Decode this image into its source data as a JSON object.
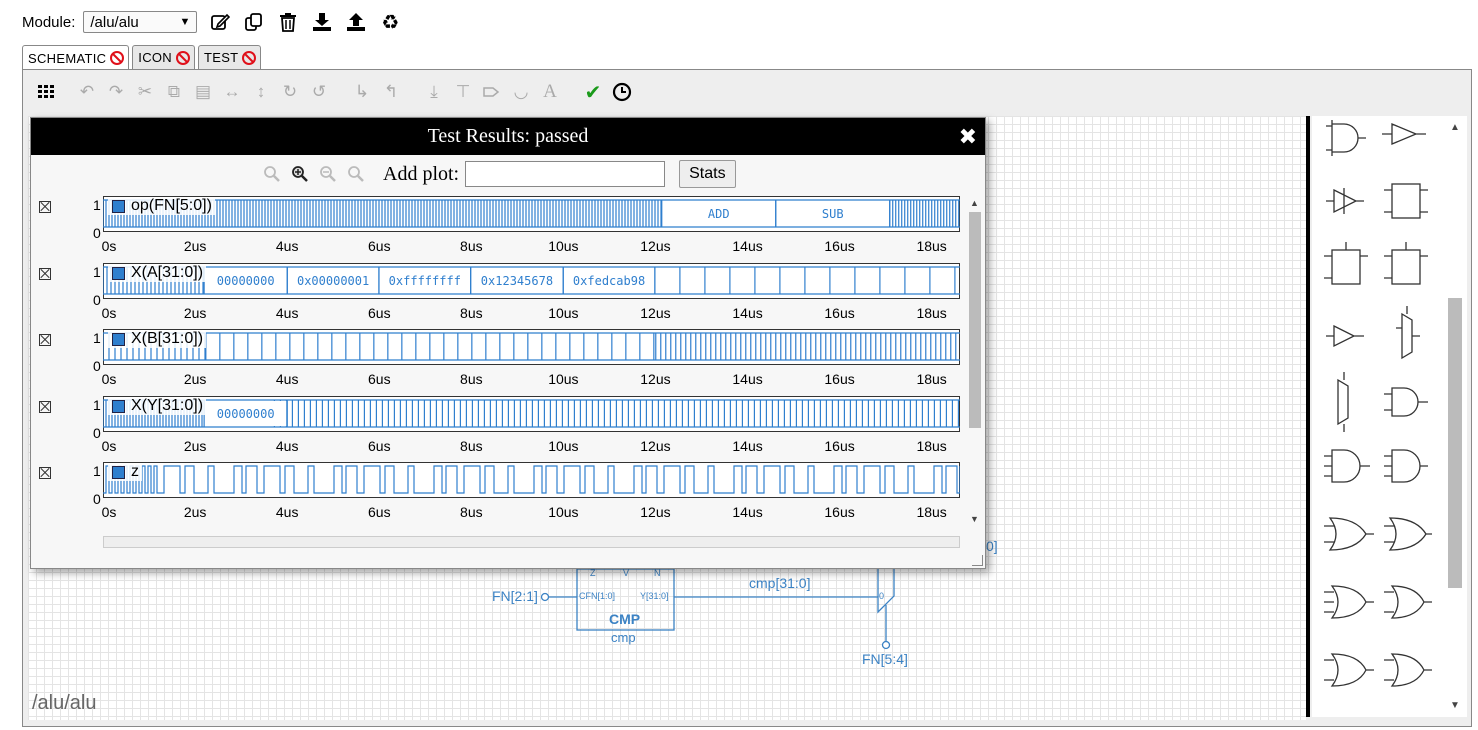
{
  "header": {
    "module_label": "Module:",
    "module_value": "/alu/alu"
  },
  "tabs": [
    {
      "label": "SCHEMATIC"
    },
    {
      "label": "ICON"
    },
    {
      "label": "TEST"
    }
  ],
  "canvas": {
    "module_path": "/alu/alu",
    "labels": {
      "fn21": "FN[2:1]",
      "fn54": "FN[5:4]",
      "cmp_bus": "cmp[31:0]",
      "cmp_title": "CMP",
      "cmp_inst": "cmp",
      "cfn": "CFN[1:0]",
      "y": "Y[31:0]",
      "z_pin": "Z",
      "v_pin": "V",
      "n_pin": "N",
      "mux_in": "0",
      "partial": "0]"
    }
  },
  "dialog": {
    "title": "Test Results: passed",
    "add_plot_label": "Add plot:",
    "add_plot_value": "",
    "stats_label": "Stats",
    "time_ticks": [
      "0s",
      "2us",
      "4us",
      "6us",
      "8us",
      "10us",
      "12us",
      "14us",
      "16us",
      "18us"
    ],
    "y_top": "1",
    "y_bottom": "0",
    "plots": [
      {
        "name": "op(FN[5:0])",
        "segments": [
          "ADD",
          "SUB"
        ]
      },
      {
        "name": "X(A[31:0])",
        "segments": [
          "00000000",
          "0x00000001",
          "0xffffffff",
          "0x12345678",
          "0xfedcab98"
        ]
      },
      {
        "name": "X(B[31:0])",
        "segments": []
      },
      {
        "name": "X(Y[31:0])",
        "segments": [
          "00000000"
        ]
      },
      {
        "name": "z",
        "segments": []
      }
    ],
    "colors": {
      "wave": "#2f7fce"
    }
  }
}
